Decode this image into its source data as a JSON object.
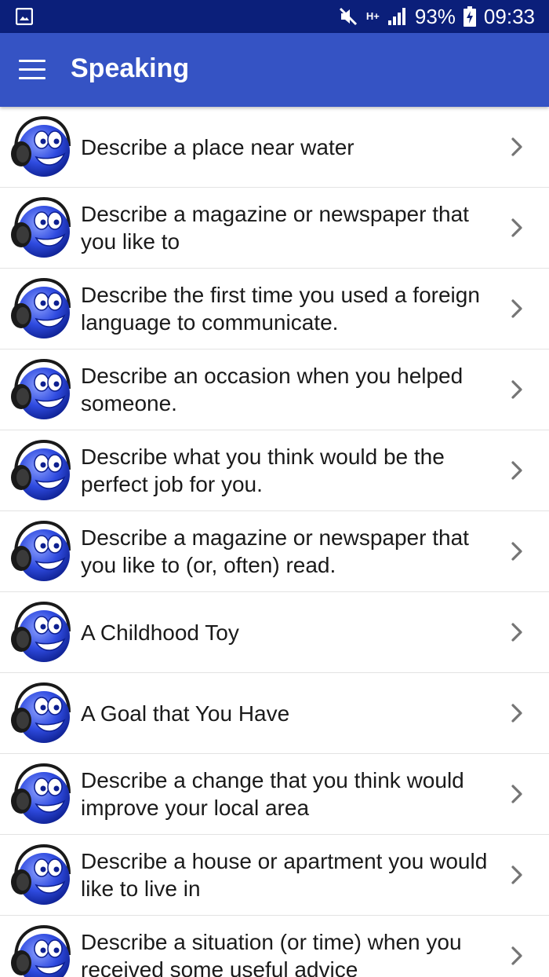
{
  "status_bar": {
    "battery": "93%",
    "time": "09:33",
    "network": "H+"
  },
  "app_bar": {
    "title": "Speaking"
  },
  "items": [
    {
      "label": "Describe a place near water"
    },
    {
      "label": "Describe a magazine or newspaper that you like to"
    },
    {
      "label": "Describe the first time you used a foreign language to communicate."
    },
    {
      "label": "Describe an occasion when you helped someone."
    },
    {
      "label": "Describe what you think would be the perfect job for you."
    },
    {
      "label": "Describe a magazine or newspaper that you like to (or, often) read."
    },
    {
      "label": "A Childhood Toy"
    },
    {
      "label": "A Goal that You Have"
    },
    {
      "label": "Describe a change that you think would improve your local area"
    },
    {
      "label": "Describe a house or apartment you would like to live in"
    },
    {
      "label": "Describe a situation (or time) when you received some useful advice"
    }
  ],
  "icons": {
    "item_avatar": "headphones-smiley-icon",
    "item_arrow": "chevron-right-icon",
    "menu": "hamburger-menu-icon"
  },
  "colors": {
    "status_bar": "#0b1f7a",
    "app_bar": "#3553c4",
    "avatar_blue": "#2f4be0"
  }
}
